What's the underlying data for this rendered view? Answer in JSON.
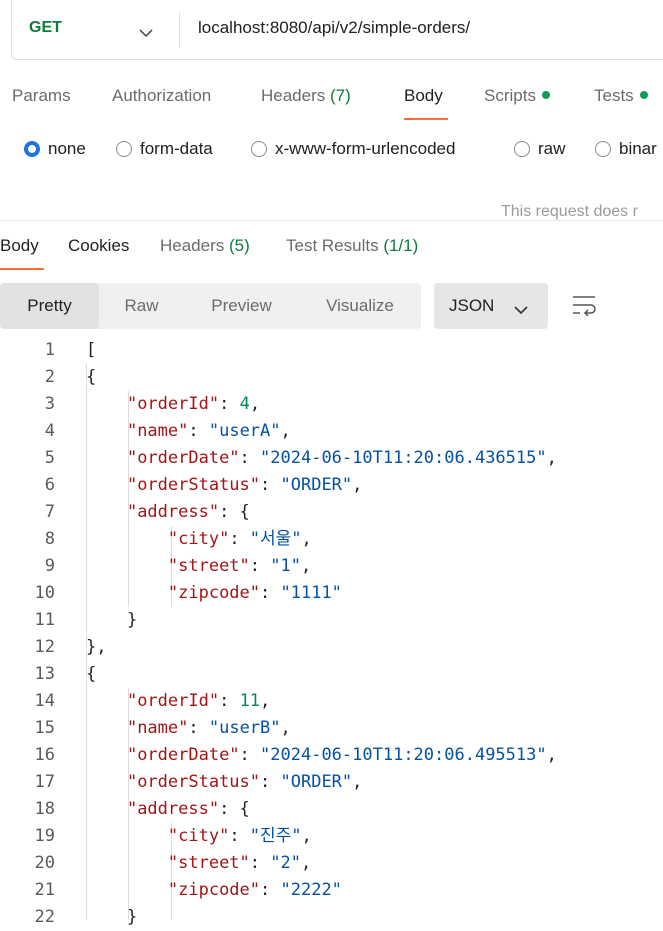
{
  "request": {
    "method": "GET",
    "url": "localhost:8080/api/v2/simple-orders/"
  },
  "request_tabs": {
    "params": "Params",
    "authorization": "Authorization",
    "headers": "Headers",
    "headers_count": "(7)",
    "body": "Body",
    "scripts": "Scripts",
    "tests": "Tests"
  },
  "body_types": {
    "none": "none",
    "form_data": "form-data",
    "urlencoded": "x-www-form-urlencoded",
    "raw": "raw",
    "binary": "binar",
    "selected": "none",
    "note": "This request does r"
  },
  "response_tabs": {
    "body": "Body",
    "cookies": "Cookies",
    "headers": "Headers",
    "headers_count": "(5)",
    "test_results": "Test Results",
    "test_results_count": "(1/1)"
  },
  "view": {
    "pretty": "Pretty",
    "raw": "Raw",
    "preview": "Preview",
    "visualize": "Visualize",
    "format": "JSON"
  },
  "code_lines": [
    "[",
    "    {",
    "        \"orderId\": 4,",
    "        \"name\": \"userA\",",
    "        \"orderDate\": \"2024-06-10T11:20:06.436515\",",
    "        \"orderStatus\": \"ORDER\",",
    "        \"address\": {",
    "            \"city\": \"서울\",",
    "            \"street\": \"1\",",
    "            \"zipcode\": \"1111\"",
    "        }",
    "    },",
    "    {",
    "        \"orderId\": 11,",
    "        \"name\": \"userB\",",
    "        \"orderDate\": \"2024-06-10T11:20:06.495513\",",
    "        \"orderStatus\": \"ORDER\",",
    "        \"address\": {",
    "            \"city\": \"진주\",",
    "            \"street\": \"2\",",
    "            \"zipcode\": \"2222\"",
    "        }"
  ],
  "colors": {
    "accent": "#ff6c37",
    "get_method": "#0f7a3a",
    "count_green": "#0f7a3a",
    "radio_selected": "#1a73e8",
    "json_key": "#a31515",
    "json_string": "#0451a5",
    "json_number": "#098658"
  }
}
